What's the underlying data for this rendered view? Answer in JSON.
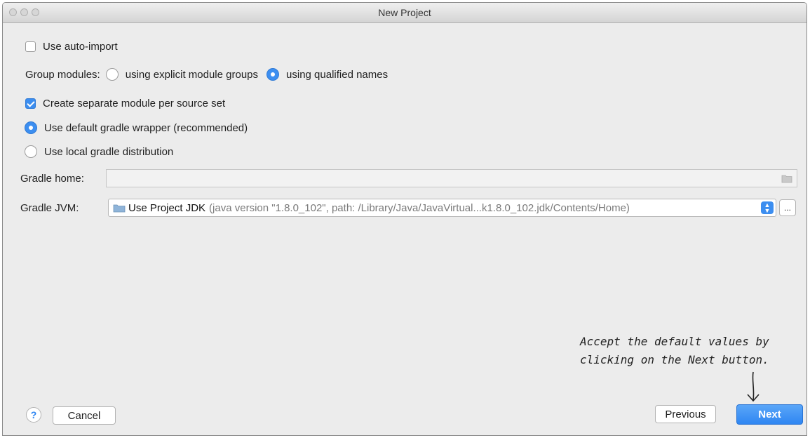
{
  "window": {
    "title": "New Project"
  },
  "options": {
    "auto_import_label": "Use auto-import",
    "auto_import_checked": false,
    "group_modules_label": "Group modules:",
    "group_explicit_label": "using explicit module groups",
    "group_qualified_label": "using qualified names",
    "separate_module_label": "Create separate module per source set",
    "separate_module_checked": true,
    "default_wrapper_label": "Use default gradle wrapper (recommended)",
    "local_distribution_label": "Use local gradle distribution"
  },
  "gradle_home": {
    "label": "Gradle home:",
    "value": ""
  },
  "gradle_jvm": {
    "label": "Gradle JVM:",
    "selected_name": "Use Project JDK",
    "selected_detail": "(java version \"1.8.0_102\", path: /Library/Java/JavaVirtual...k1.8.0_102.jdk/Contents/Home)",
    "browse_label": "..."
  },
  "footer": {
    "help_label": "?",
    "cancel_label": "Cancel",
    "previous_label": "Previous",
    "next_label": "Next"
  },
  "annotation": {
    "line1": "Accept the default values by",
    "line2": "clicking on the Next button."
  },
  "colors": {
    "accent": "#3c8ef0",
    "window_bg": "#ececec"
  }
}
